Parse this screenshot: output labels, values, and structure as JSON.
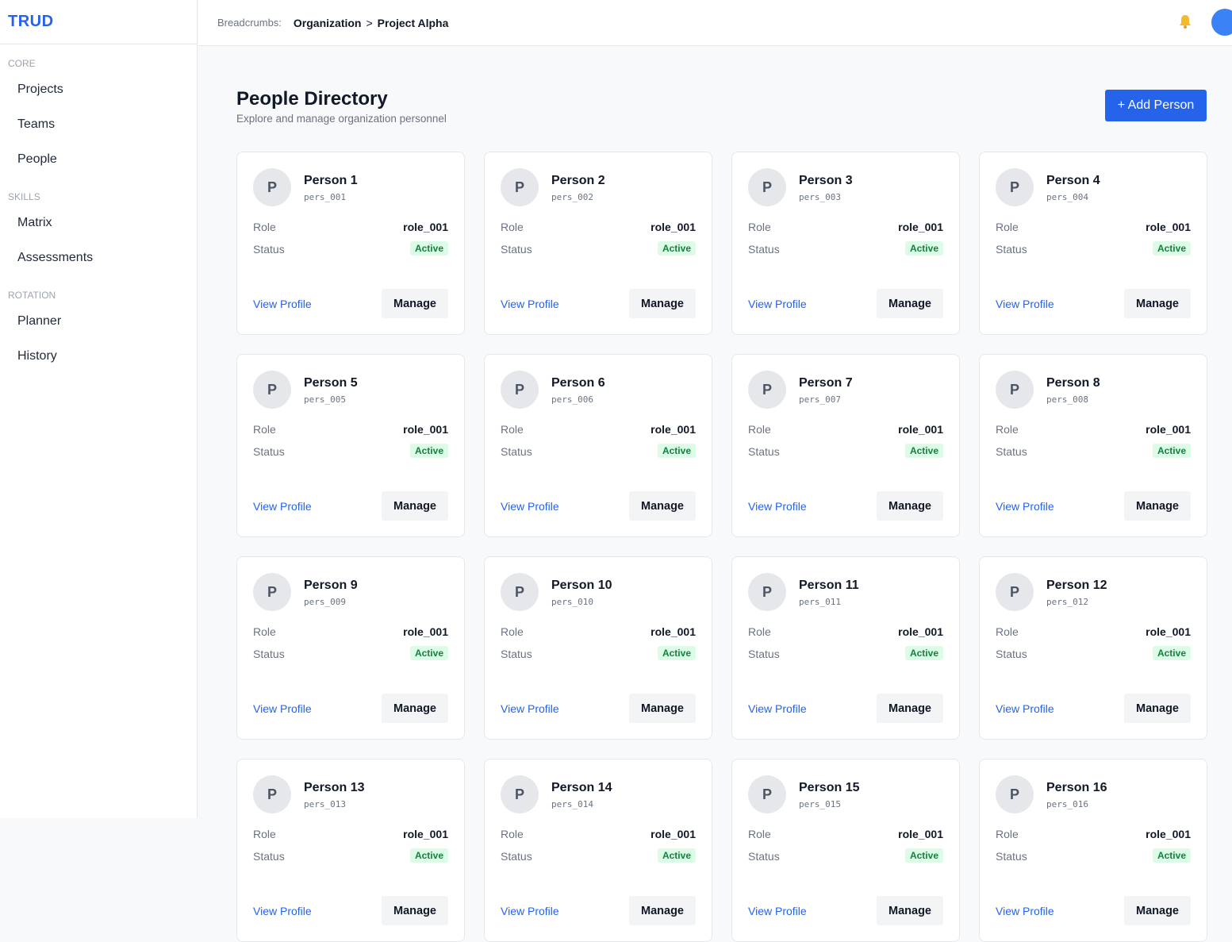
{
  "app": {
    "name": "TRUD"
  },
  "sidebar": {
    "sections": [
      {
        "label": "CORE",
        "items": [
          "Projects",
          "Teams",
          "People"
        ]
      },
      {
        "label": "SKILLS",
        "items": [
          "Matrix",
          "Assessments"
        ]
      },
      {
        "label": "ROTATION",
        "items": [
          "Planner",
          "History"
        ]
      }
    ]
  },
  "header": {
    "breadcrumb_label": "Breadcrumbs:",
    "crumbs": [
      "Organization",
      "Project Alpha"
    ],
    "separator": ">",
    "icons": [
      "bell-icon",
      "user-avatar"
    ]
  },
  "page": {
    "title": "People Directory",
    "subtitle": "Explore and manage organization personnel",
    "add_button": "+ Add Person"
  },
  "card_labels": {
    "role": "Role",
    "status": "Status",
    "view": "View Profile",
    "manage": "Manage"
  },
  "people": [
    {
      "initial": "P",
      "name": "Person 1",
      "id": "pers_001",
      "role": "role_001",
      "status": "Active"
    },
    {
      "initial": "P",
      "name": "Person 2",
      "id": "pers_002",
      "role": "role_001",
      "status": "Active"
    },
    {
      "initial": "P",
      "name": "Person 3",
      "id": "pers_003",
      "role": "role_001",
      "status": "Active"
    },
    {
      "initial": "P",
      "name": "Person 4",
      "id": "pers_004",
      "role": "role_001",
      "status": "Active"
    },
    {
      "initial": "P",
      "name": "Person 5",
      "id": "pers_005",
      "role": "role_001",
      "status": "Active"
    },
    {
      "initial": "P",
      "name": "Person 6",
      "id": "pers_006",
      "role": "role_001",
      "status": "Active"
    },
    {
      "initial": "P",
      "name": "Person 7",
      "id": "pers_007",
      "role": "role_001",
      "status": "Active"
    },
    {
      "initial": "P",
      "name": "Person 8",
      "id": "pers_008",
      "role": "role_001",
      "status": "Active"
    },
    {
      "initial": "P",
      "name": "Person 9",
      "id": "pers_009",
      "role": "role_001",
      "status": "Active"
    },
    {
      "initial": "P",
      "name": "Person 10",
      "id": "pers_010",
      "role": "role_001",
      "status": "Active"
    },
    {
      "initial": "P",
      "name": "Person 11",
      "id": "pers_011",
      "role": "role_001",
      "status": "Active"
    },
    {
      "initial": "P",
      "name": "Person 12",
      "id": "pers_012",
      "role": "role_001",
      "status": "Active"
    },
    {
      "initial": "P",
      "name": "Person 13",
      "id": "pers_013",
      "role": "role_001",
      "status": "Active"
    },
    {
      "initial": "P",
      "name": "Person 14",
      "id": "pers_014",
      "role": "role_001",
      "status": "Active"
    },
    {
      "initial": "P",
      "name": "Person 15",
      "id": "pers_015",
      "role": "role_001",
      "status": "Active"
    },
    {
      "initial": "P",
      "name": "Person 16",
      "id": "pers_016",
      "role": "role_001",
      "status": "Active"
    }
  ],
  "colors": {
    "accent": "#2563eb",
    "active_bg": "#dcfce7",
    "active_fg": "#15803d"
  }
}
